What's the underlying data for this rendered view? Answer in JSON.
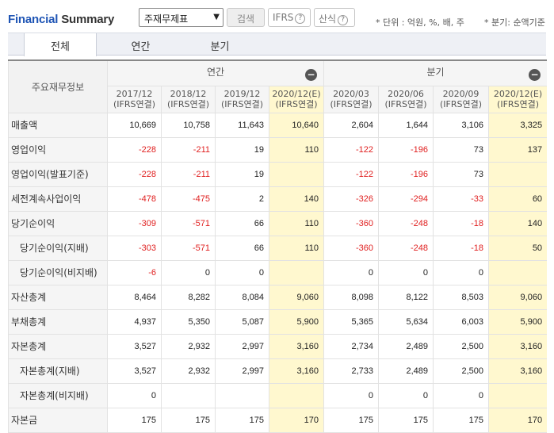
{
  "header": {
    "brand_part1": "Financial",
    "brand_part2": "Summary",
    "select_value": "주재무제표",
    "search_label": "검색",
    "ifrs_label": "IFRS",
    "formula_label": "산식",
    "help_glyph": "?",
    "unit_note": "* 단위 : 억원, %, 배, 주",
    "quarter_note": "* 분기: 순액기준"
  },
  "tabs": [
    "전체",
    "연간",
    "분기"
  ],
  "table": {
    "row_header_label": "주요재무정보",
    "group_annual": "연간",
    "group_quarter": "분기",
    "collapse_glyph": "−",
    "columns": [
      {
        "period": "2017/12",
        "basis": "(IFRS연결)"
      },
      {
        "period": "2018/12",
        "basis": "(IFRS연결)"
      },
      {
        "period": "2019/12",
        "basis": "(IFRS연결)"
      },
      {
        "period": "2020/12(E)",
        "basis": "(IFRS연결)"
      },
      {
        "period": "2020/03",
        "basis": "(IFRS연결)"
      },
      {
        "period": "2020/06",
        "basis": "(IFRS연결)"
      },
      {
        "period": "2020/09",
        "basis": "(IFRS연결)"
      },
      {
        "period": "2020/12(E)",
        "basis": "(IFRS연결)"
      }
    ],
    "rows": [
      {
        "label": "매출액",
        "values": [
          "10,669",
          "10,758",
          "11,643",
          "10,640",
          "2,604",
          "1,644",
          "3,106",
          "3,325"
        ]
      },
      {
        "label": "영업이익",
        "values": [
          "-228",
          "-211",
          "19",
          "110",
          "-122",
          "-196",
          "73",
          "137"
        ]
      },
      {
        "label": "영업이익(발표기준)",
        "values": [
          "-228",
          "-211",
          "19",
          "",
          "-122",
          "-196",
          "73",
          ""
        ]
      },
      {
        "label": "세전계속사업이익",
        "values": [
          "-478",
          "-475",
          "2",
          "140",
          "-326",
          "-294",
          "-33",
          "60"
        ]
      },
      {
        "label": "당기순이익",
        "values": [
          "-309",
          "-571",
          "66",
          "110",
          "-360",
          "-248",
          "-18",
          "140"
        ]
      },
      {
        "label": "당기순이익(지배)",
        "values": [
          "-303",
          "-571",
          "66",
          "110",
          "-360",
          "-248",
          "-18",
          "50"
        ]
      },
      {
        "label": "당기순이익(비지배)",
        "values": [
          "-6",
          "0",
          "0",
          "",
          "0",
          "0",
          "0",
          ""
        ]
      },
      {
        "label": "자산총계",
        "values": [
          "8,464",
          "8,282",
          "8,084",
          "9,060",
          "8,098",
          "8,122",
          "8,503",
          "9,060"
        ]
      },
      {
        "label": "부채총계",
        "values": [
          "4,937",
          "5,350",
          "5,087",
          "5,900",
          "5,365",
          "5,634",
          "6,003",
          "5,900"
        ]
      },
      {
        "label": "자본총계",
        "values": [
          "3,527",
          "2,932",
          "2,997",
          "3,160",
          "2,734",
          "2,489",
          "2,500",
          "3,160"
        ]
      },
      {
        "label": "자본총계(지배)",
        "values": [
          "3,527",
          "2,932",
          "2,997",
          "3,160",
          "2,733",
          "2,489",
          "2,500",
          "3,160"
        ]
      },
      {
        "label": "자본총계(비지배)",
        "values": [
          "0",
          "",
          "",
          "",
          "0",
          "0",
          "0",
          ""
        ]
      },
      {
        "label": "자본금",
        "values": [
          "175",
          "175",
          "175",
          "170",
          "175",
          "175",
          "175",
          "170"
        ]
      }
    ]
  },
  "colors": {
    "brand_blue": "#1f55b5",
    "negative": "#e02020",
    "estimate_bg": "#fff8cf"
  }
}
